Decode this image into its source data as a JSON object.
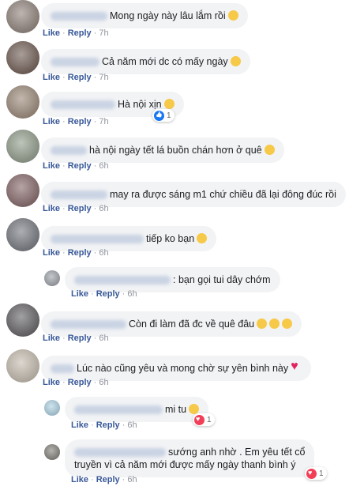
{
  "actions": {
    "like": "Like",
    "reply": "Reply"
  },
  "comments": [
    {
      "text": "Mong ngày này lâu lắm rồi",
      "emoji": "rofl",
      "time": "7h"
    },
    {
      "text": "Cả năm mới dc có mấy ngày",
      "emoji": "smile",
      "time": "7h"
    },
    {
      "text": "Hà nội xịn",
      "emoji": "smile",
      "time": "7h",
      "reaction": {
        "type": "like",
        "count": "1"
      }
    },
    {
      "text": "hà nội ngày tết lá buồn chán hơn ở quê",
      "emoji": "smile",
      "time": "6h"
    },
    {
      "text": "may ra được sáng m1 chứ chiều đã lại đông đúc rồi",
      "time": "6h"
    },
    {
      "text": "tiếp ko bạn",
      "emoji": "smile",
      "time": "6h"
    },
    {
      "text": ": bạn gọi tui dây chớm",
      "time": "6h",
      "reply": true
    },
    {
      "text": "Còn đi làm đã đc về quê đâu",
      "emoji": "laugh",
      "time": "6h"
    },
    {
      "text": "Lúc nào cũng yêu và mong chờ sự yên bình này",
      "emoji": "heart",
      "time": "6h"
    },
    {
      "text": "mi tu",
      "emoji": "blush",
      "time": "6h",
      "reply": true,
      "reaction": {
        "type": "love",
        "count": "1"
      }
    },
    {
      "text_line1": "sướng anh nhờ . Em yêu tết cổ",
      "text_line2": "truyền vì cả năm mới được mấy ngày thanh bình ý",
      "time": "6h",
      "reply": true,
      "reaction": {
        "type": "love",
        "count": "1"
      }
    }
  ]
}
